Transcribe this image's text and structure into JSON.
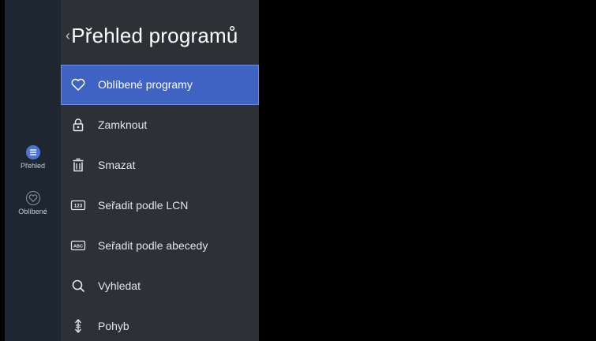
{
  "rail": {
    "items": [
      {
        "label": "Přehled",
        "icon": "list-icon",
        "active": true
      },
      {
        "label": "Oblíbené",
        "icon": "heart-icon",
        "active": false
      }
    ]
  },
  "panel": {
    "title": "Přehled programů",
    "back_glyph": "‹"
  },
  "menu": {
    "items": [
      {
        "label": "Oblíbené programy",
        "icon": "heart-icon",
        "selected": true
      },
      {
        "label": "Zamknout",
        "icon": "lock-icon",
        "selected": false
      },
      {
        "label": "Smazat",
        "icon": "trash-icon",
        "selected": false
      },
      {
        "label": "Seřadit podle LCN",
        "icon": "sort-123-icon",
        "badge": "123",
        "selected": false
      },
      {
        "label": "Seřadit podle abecedy",
        "icon": "sort-abc-icon",
        "badge": "ABC",
        "selected": false
      },
      {
        "label": "Vyhledat",
        "icon": "search-icon",
        "selected": false
      },
      {
        "label": "Pohyb",
        "icon": "move-icon",
        "selected": false
      }
    ]
  },
  "colors": {
    "background": "#000000",
    "rail": "#1e2631",
    "panel": "#2d3034",
    "selected": "#3f63c2",
    "accent": "#4b74d6"
  }
}
